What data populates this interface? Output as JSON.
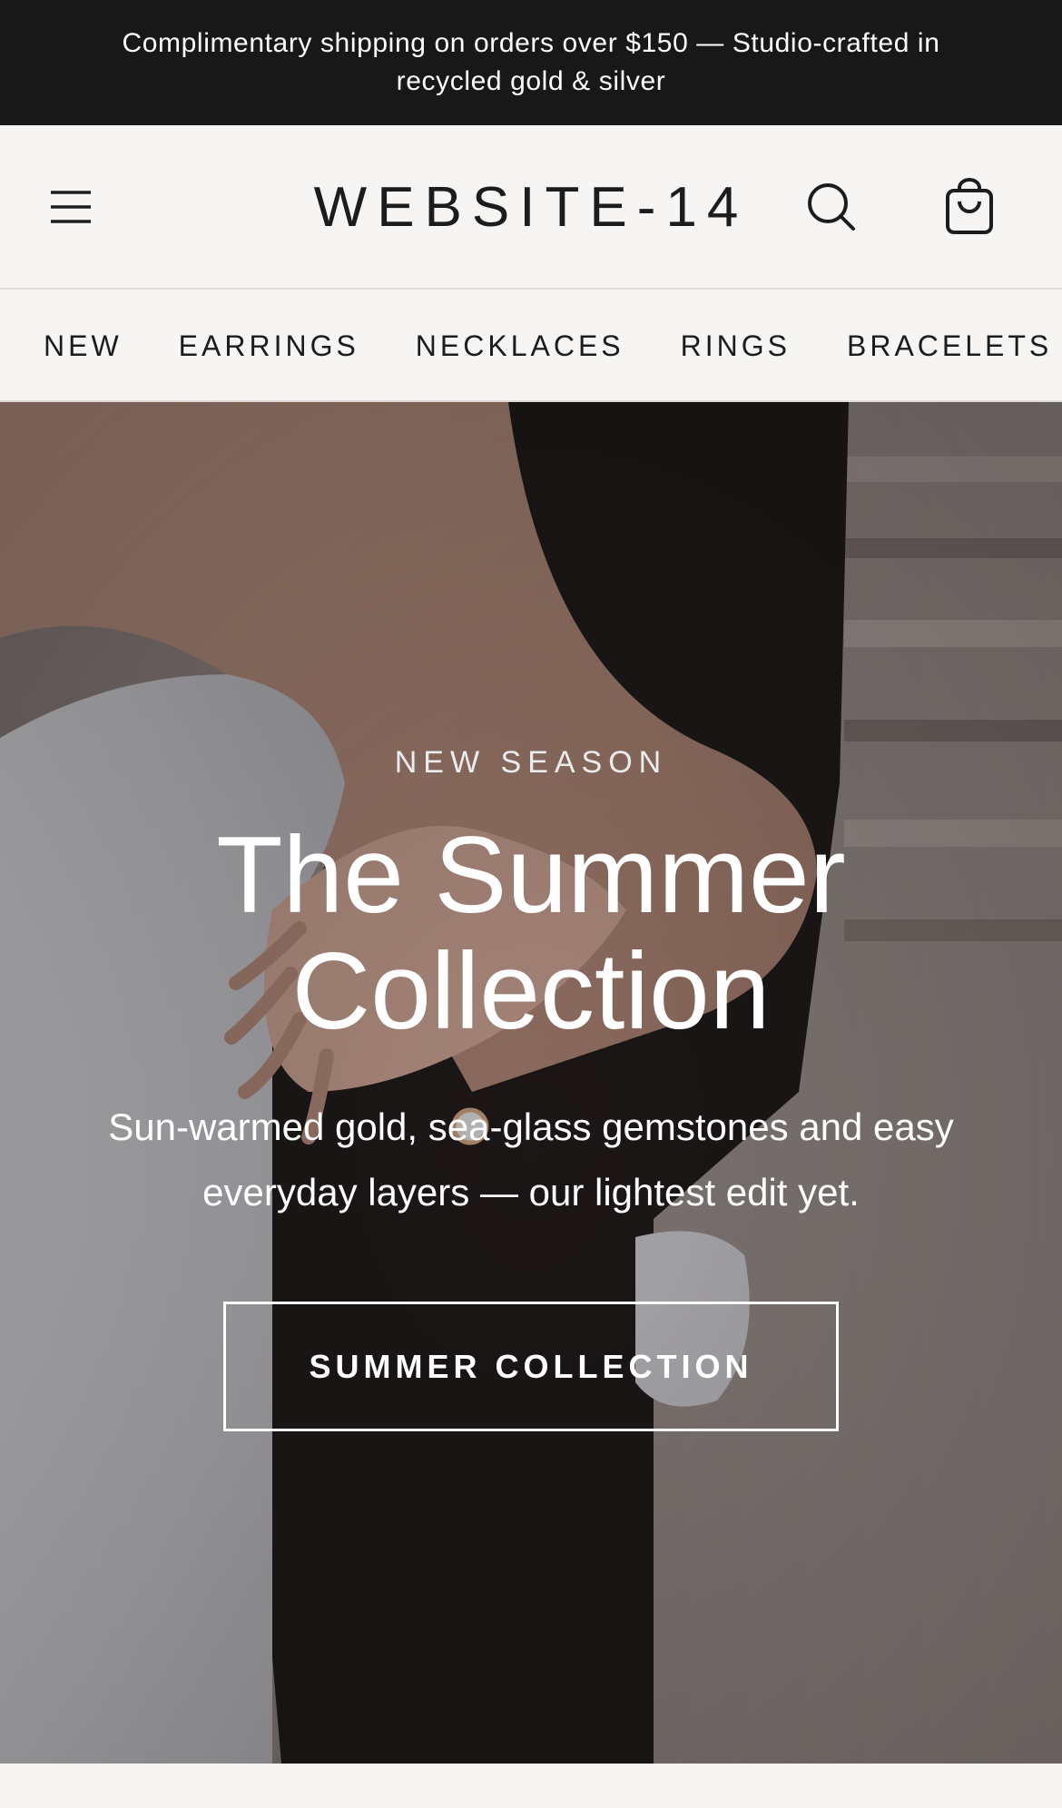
{
  "announcement": {
    "text": "Complimentary shipping on orders over $150 — Studio-crafted in recycled gold & silver"
  },
  "header": {
    "logo": "WEBSITE-14",
    "icons": {
      "menu": "menu-icon",
      "search": "search-icon",
      "cart": "shopping-bag-icon"
    }
  },
  "nav": {
    "items": [
      {
        "label": "NEW"
      },
      {
        "label": "EARRINGS"
      },
      {
        "label": "NECKLACES"
      },
      {
        "label": "RINGS"
      },
      {
        "label": "BRACELETS"
      }
    ]
  },
  "hero": {
    "eyebrow": "NEW SEASON",
    "title_line1": "The Summer",
    "title_line2": "Collection",
    "subtitle": "Sun-warmed gold, sea-glass gemstones and easy everyday layers — our lightest edit yet.",
    "cta_label": "SUMMER COLLECTION"
  },
  "colors": {
    "announcement_bg": "#181818",
    "page_bg": "#f6f5f3",
    "text_dark": "#1c1c1c",
    "divider": "#e0dbd6"
  }
}
